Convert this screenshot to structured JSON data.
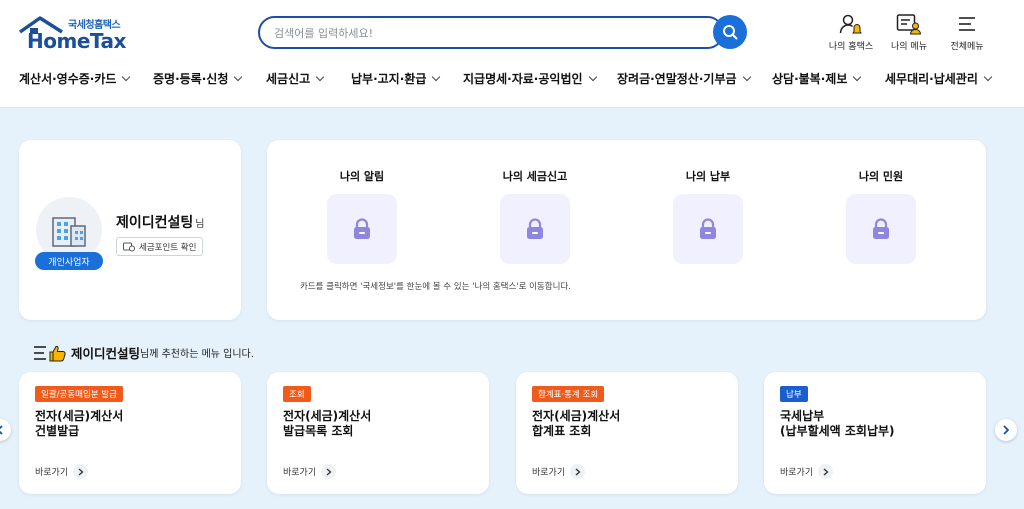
{
  "logo": {
    "subtitle": "국세청홈택스",
    "name": "HomeTax"
  },
  "search": {
    "placeholder": "검색어를 입력하세요!"
  },
  "header_links": [
    {
      "label": "나의 홈택스",
      "icon": "user-bell-icon"
    },
    {
      "label": "나의 메뉴",
      "icon": "my-menu-icon"
    },
    {
      "label": "전체메뉴",
      "icon": "hamburger-icon"
    }
  ],
  "gnb": [
    "계산서·영수증·카드",
    "증명·등록·신청",
    "세금신고",
    "납부·고지·환급",
    "지급명세·자료·공익법인",
    "장려금·연말정산·기부금",
    "상담·불복·제보",
    "세무대리·납세관리"
  ],
  "profile": {
    "name": "제이디컨설팅",
    "suffix": "님",
    "badge": "개인사업자",
    "tax_point_btn": "세금포인트 확인"
  },
  "my": {
    "items": [
      "나의 알림",
      "나의 세금신고",
      "나의 납부",
      "나의 민원"
    ],
    "note": "카드를 클릭하면 '국세정보'를 한눈에 볼 수 있는 '나의 홈택스'로 이동합니다."
  },
  "recommend": {
    "name": "제이디컨설팅",
    "rest": "님께 추천하는 메뉴 입니다.",
    "go_label": "바로가기",
    "cards": [
      {
        "tag": "일괄/공동매입분 발급",
        "tag_color": "#f05a1a",
        "line1": "전자(세금)계산서",
        "line2": "건별발급"
      },
      {
        "tag": "조회",
        "tag_color": "#f05a1a",
        "line1": "전자(세금)계산서",
        "line2": "발급목록 조회"
      },
      {
        "tag": "합계표·통계 조회",
        "tag_color": "#f05a1a",
        "line1": "전자(세금)계산서",
        "line2": "합계표 조회"
      },
      {
        "tag": "납부",
        "tag_color": "#1a5fd0",
        "line1": "국세납부",
        "line2": "(납부할세액 조회납부)"
      }
    ]
  }
}
